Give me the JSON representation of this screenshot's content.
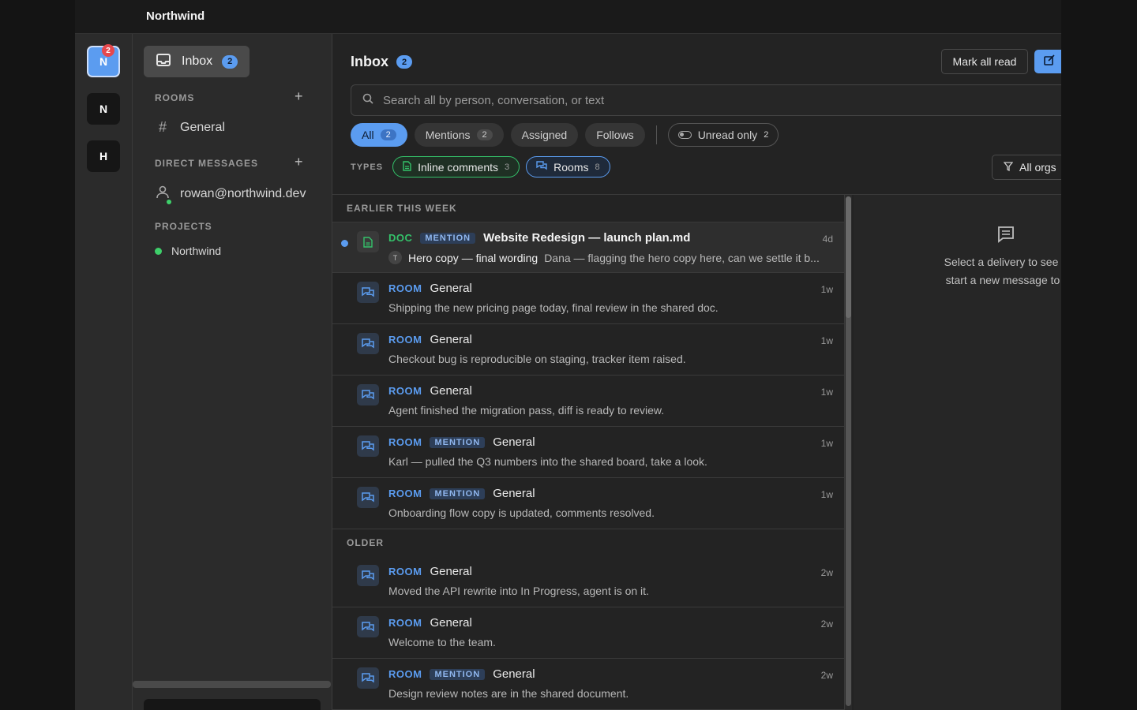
{
  "app": {
    "title": "Northwind"
  },
  "orgs": [
    {
      "letter": "N",
      "badge": "2",
      "active": true
    },
    {
      "letter": "N"
    },
    {
      "letter": "H"
    }
  ],
  "sidebar": {
    "inbox_label": "Inbox",
    "inbox_count": "2",
    "rooms_heading": "ROOMS",
    "rooms": [
      {
        "label": "General"
      }
    ],
    "dm_heading": "DIRECT MESSAGES",
    "dms": [
      {
        "label": "rowan@northwind.dev"
      }
    ],
    "projects_heading": "PROJECTS",
    "projects": [
      {
        "label": "Northwind",
        "color": "#3ecf6a"
      }
    ]
  },
  "main": {
    "title": "Inbox",
    "count": "2",
    "mark_all_read": "Mark all read",
    "search_placeholder": "Search all by person, conversation, or text",
    "filters": [
      {
        "label": "All",
        "count": "2",
        "active": true
      },
      {
        "label": "Mentions",
        "count": "2"
      },
      {
        "label": "Assigned"
      },
      {
        "label": "Follows"
      }
    ],
    "unread_only": {
      "label": "Unread only",
      "count": "2"
    },
    "types_label": "TYPES",
    "types": [
      {
        "label": "Inline comments",
        "count": "3",
        "color": "#34c26a"
      },
      {
        "label": "Rooms",
        "count": "8",
        "color": "#5b9cf0"
      }
    ],
    "all_orgs": "All orgs"
  },
  "groups": [
    {
      "label": "EARLIER THIS WEEK",
      "items": [
        {
          "kind": "DOC",
          "mention": "MENTION",
          "title": "Website Redesign — launch plan.md",
          "time": "4d",
          "avatar": "T",
          "subject": "Hero copy — final wording",
          "preview": "Dana — flagging the hero copy here, can we settle it b...",
          "unread": true
        },
        {
          "kind": "ROOM",
          "title": "General",
          "time": "1w",
          "preview": "Shipping the new pricing page today, final review in the shared doc."
        },
        {
          "kind": "ROOM",
          "title": "General",
          "time": "1w",
          "preview": "Checkout bug is reproducible on staging, tracker item raised."
        },
        {
          "kind": "ROOM",
          "title": "General",
          "time": "1w",
          "preview": "Agent finished the migration pass, diff is ready to review."
        },
        {
          "kind": "ROOM",
          "mention": "MENTION",
          "title": "General",
          "time": "1w",
          "preview": "Karl — pulled the Q3 numbers into the shared board, take a look."
        },
        {
          "kind": "ROOM",
          "mention": "MENTION",
          "title": "General",
          "time": "1w",
          "preview": "Onboarding flow copy is updated, comments resolved."
        }
      ]
    },
    {
      "label": "OLDER",
      "items": [
        {
          "kind": "ROOM",
          "title": "General",
          "time": "2w",
          "preview": "Moved the API rewrite into In Progress, agent is on it."
        },
        {
          "kind": "ROOM",
          "title": "General",
          "time": "2w",
          "preview": "Welcome to the team."
        },
        {
          "kind": "ROOM",
          "mention": "MENTION",
          "title": "General",
          "time": "2w",
          "preview": "Design review notes are in the shared document."
        }
      ]
    }
  ],
  "detail": {
    "line1": "Select a delivery to see its conte",
    "line2": "start a new message to pick a d"
  }
}
